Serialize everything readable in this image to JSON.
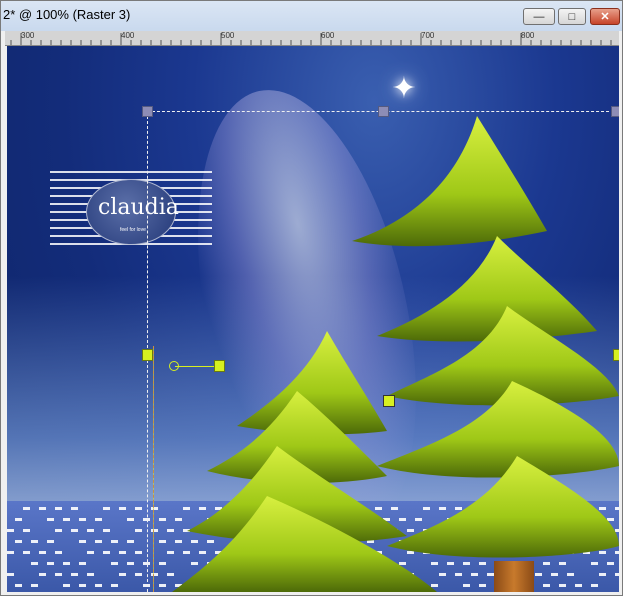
{
  "window": {
    "title": "2* @ 100% (Raster 3)",
    "buttons": {
      "minimize": "—",
      "maximize": "□",
      "close": "✕"
    }
  },
  "ruler": {
    "labels": [
      "300",
      "400",
      "500",
      "600",
      "700",
      "800"
    ]
  },
  "canvas": {
    "logo_text": "claudia",
    "logo_subtext": "feel for love",
    "star_glyph": "✦"
  },
  "icons": {
    "star": "sparkle-star-icon",
    "minimize": "minimize-icon",
    "maximize": "maximize-icon",
    "close": "close-icon"
  },
  "colors": {
    "sky": "#132c7a",
    "tree": "#b6e01a",
    "handle": "#8d8db6",
    "handle_active": "#d7f020",
    "guide": "#cc2222"
  }
}
